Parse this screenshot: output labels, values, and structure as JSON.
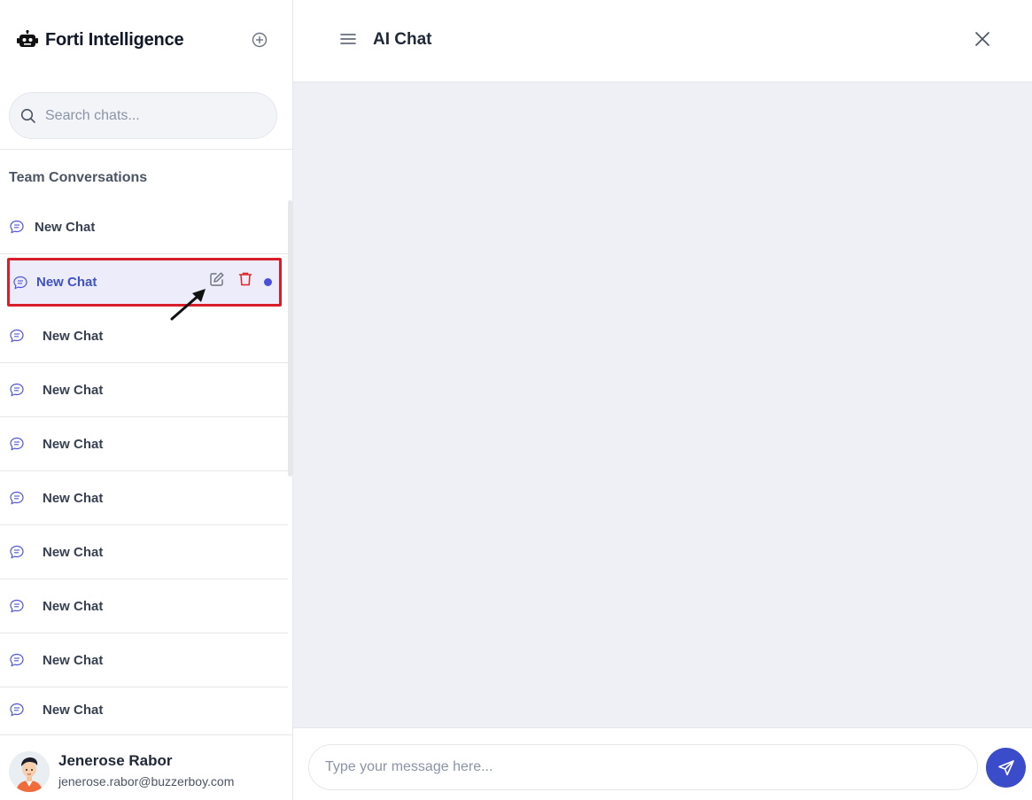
{
  "sidebar": {
    "brand_title": "Forti Intelligence",
    "search_placeholder": "Search chats...",
    "section_title": "Team Conversations",
    "chats": [
      {
        "label": "New Chat",
        "active": false
      },
      {
        "label": "New Chat",
        "active": true
      },
      {
        "label": "New Chat",
        "active": false
      },
      {
        "label": "New Chat",
        "active": false
      },
      {
        "label": "New Chat",
        "active": false
      },
      {
        "label": "New Chat",
        "active": false
      },
      {
        "label": "New Chat",
        "active": false
      },
      {
        "label": "New Chat",
        "active": false
      },
      {
        "label": "New Chat",
        "active": false
      },
      {
        "label": "New Chat",
        "active": false
      }
    ],
    "user": {
      "name": "Jenerose Rabor",
      "email": "jenerose.rabor@buzzerboy.com"
    }
  },
  "header": {
    "title": "AI Chat"
  },
  "composer": {
    "placeholder": "Type your message here..."
  },
  "icons": {
    "brand": "robot-icon",
    "new_chat": "plus-circle-icon",
    "search": "search-icon",
    "chat": "chat-bubble-icon",
    "edit": "edit-icon",
    "delete": "trash-icon",
    "menu": "hamburger-menu-icon",
    "close": "close-icon",
    "send": "send-icon"
  },
  "colors": {
    "accent": "#3b4cca",
    "active_bg": "#ececfa",
    "highlight_border": "#d81e2a",
    "delete": "#dc2626",
    "main_bg": "#eef0f5"
  }
}
